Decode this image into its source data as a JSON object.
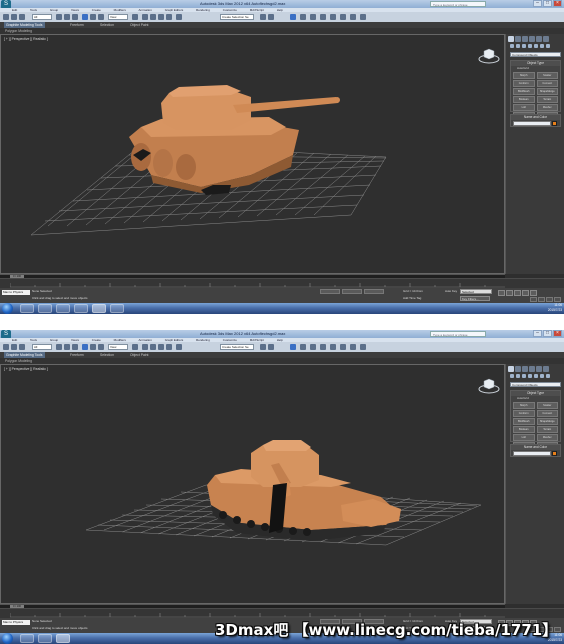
{
  "screenshots": [
    {
      "window_title": "Autodesk 3ds Max 2012 x64    Autoflechsgd2.max",
      "help_search_placeholder": "Type a keyword or phrase",
      "menu_items": [
        "Edit",
        "Tools",
        "Group",
        "Views",
        "Create",
        "Modifiers",
        "Animation",
        "Graph Editors",
        "Rendering",
        "Customize",
        "MAXScript",
        "Help"
      ],
      "toolbar": {
        "selection_filter": "All",
        "ref_coord": "View",
        "named_selection": "Create Selection Se"
      },
      "ribbon_tabs": [
        "Graphite Modeling Tools",
        "Freeform",
        "Selection",
        "Object Paint"
      ],
      "ribbon_sub": "Polygon Modeling",
      "viewport_label": "[ + ][ Perspective ][ Realistic ]",
      "command_panel": {
        "category": "Compound Objects",
        "rollout_object_type": "Object Type",
        "autogrid": "AutoGrid",
        "object_buttons": [
          "Morph",
          "Scatter",
          "Conform",
          "Connect",
          "BlobMesh",
          "ShapeMerge",
          "Boolean",
          "Terrain",
          "Loft",
          "Mesher",
          "ProBoolean",
          "ProCutter"
        ],
        "rollout_name_color": "Name and Color"
      },
      "time_slider": "0 / 100",
      "status": {
        "maxscript_listener": "Max to Physics",
        "selection": "None Selected",
        "prompt": "Click and drag to select and move objects",
        "grid": "Grid = 10.0mm",
        "add_time_tag": "Add Time Tag",
        "auto_key": "Auto Key",
        "selected_dropdown": "Selected",
        "set_key": "Set Key",
        "key_filters": "Key Filters..."
      },
      "tray": {
        "time": "11:06",
        "date": "2015/7/23"
      }
    },
    {
      "window_title": "Autodesk 3ds Max 2012 x64    Autoflechsgd2.max",
      "help_search_placeholder": "Type a keyword or phrase",
      "menu_items": [
        "Edit",
        "Tools",
        "Group",
        "Views",
        "Create",
        "Modifiers",
        "Animation",
        "Graph Editors",
        "Rendering",
        "Customize",
        "MAXScript",
        "Help"
      ],
      "toolbar": {
        "selection_filter": "All",
        "ref_coord": "View",
        "named_selection": "Create Selection Se"
      },
      "ribbon_tabs": [
        "Graphite Modeling Tools",
        "Freeform",
        "Selection",
        "Object Paint"
      ],
      "ribbon_sub": "Polygon Modeling",
      "viewport_label": "[ + ][ Perspective ][ Realistic ]",
      "command_panel": {
        "category": "Compound Objects",
        "rollout_object_type": "Object Type",
        "autogrid": "AutoGrid",
        "object_buttons": [
          "Morph",
          "Scatter",
          "Conform",
          "Connect",
          "BlobMesh",
          "ShapeMerge",
          "Boolean",
          "Terrain",
          "Loft",
          "Mesher",
          "ProBoolean",
          "ProCutter"
        ],
        "rollout_name_color": "Name and Color"
      },
      "time_slider": "0 / 100",
      "status": {
        "maxscript_listener": "Max to Physics",
        "selection": "None Selected",
        "prompt": "Click and drag to select and move objects",
        "grid": "Grid = 10.0mm",
        "add_time_tag": "Add Time Tag",
        "auto_key": "Auto Key",
        "selected_dropdown": "Selected",
        "set_key": "Set Key",
        "key_filters": "Key Filters..."
      },
      "tray": {
        "time": "11:06",
        "date": "2015/7/23"
      }
    }
  ],
  "watermark": "3Dmax吧 【www.linecg.com/tieba/1771】",
  "colors": {
    "model": "#d08a55",
    "viewport_bg": "#2e2e2e",
    "grid": "#8a8a8a",
    "name_swatch": "#e8801a"
  }
}
